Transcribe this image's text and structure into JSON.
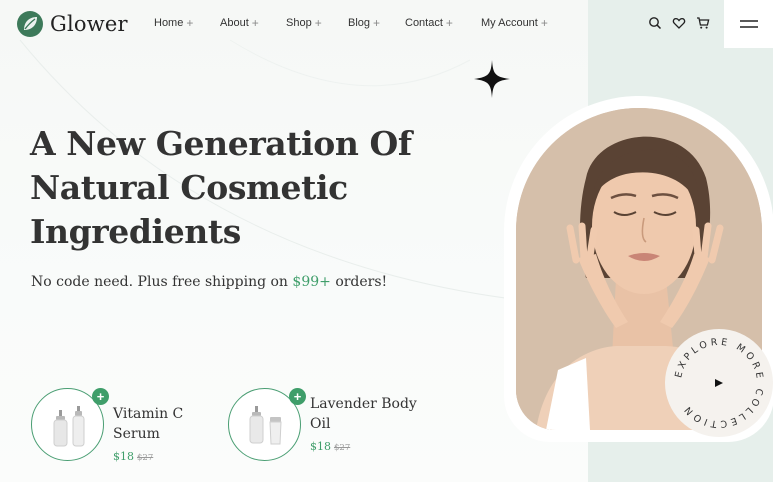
{
  "brand": {
    "name": "Glower",
    "accent": "#3f9e6a"
  },
  "nav": {
    "items": [
      {
        "label": "Home",
        "suffix": "+"
      },
      {
        "label": "About",
        "suffix": "+"
      },
      {
        "label": "Shop",
        "suffix": "+"
      },
      {
        "label": "Blog",
        "suffix": "+"
      },
      {
        "label": "Contact",
        "suffix": "+"
      },
      {
        "label": "My Account",
        "suffix": "+"
      }
    ]
  },
  "header_icons": [
    "search-icon",
    "heart-icon",
    "cart-icon",
    "hamburger-menu-icon"
  ],
  "hero": {
    "headline_1": "A New Generation Of",
    "headline_2": "Natural Cosmetic",
    "headline_3": "Ingredients",
    "sub_before": "No code need. Plus free shipping on",
    "sub_price": "$99+",
    "sub_after": "orders!"
  },
  "products": [
    {
      "name": "Vitamin C Serum",
      "price": "$18",
      "old_price": "$27"
    },
    {
      "name_1": "Lavender Body",
      "name_2": "Oil",
      "price": "$18",
      "old_price": "$27"
    }
  ],
  "explore_badge": {
    "text": "EXPLORE MORE COLLECTION"
  }
}
